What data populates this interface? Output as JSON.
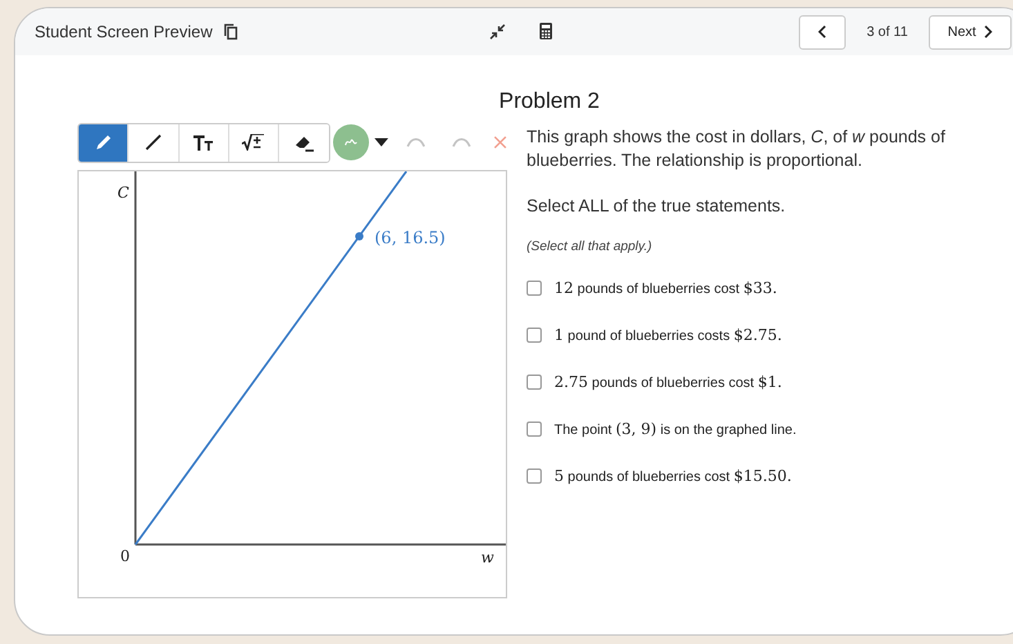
{
  "header": {
    "title": "Student Screen Preview",
    "page_indicator": "3 of 11",
    "next_label": "Next"
  },
  "problem": {
    "title": "Problem 2"
  },
  "toolbar": {
    "tools": [
      {
        "kind": "pencil",
        "selected": true
      },
      {
        "kind": "line",
        "selected": false
      },
      {
        "kind": "text",
        "selected": false
      },
      {
        "kind": "math",
        "selected": false
      },
      {
        "kind": "eraser",
        "selected": false
      }
    ],
    "color": "#8dbf8f",
    "undo_disabled": true,
    "redo_disabled": true
  },
  "graph": {
    "y_label": "C",
    "x_label": "w",
    "origin_label": "0",
    "point_label": "(6, 16.5)"
  },
  "prompt": {
    "intro": "This graph shows the cost in dollars, *C*, of *w* pounds of blueberries. The relationship is proportional.",
    "instruction": "Select ALL of the true statements.",
    "hint": "(Select all that apply.)"
  },
  "options": [
    {
      "checked": false,
      "parts": [
        {
          "kind": "math",
          "text": "12"
        },
        {
          "kind": "text",
          "text": " pounds of blueberries cost "
        },
        {
          "kind": "math",
          "text": "$33"
        },
        {
          "kind": "math",
          "text": "."
        }
      ]
    },
    {
      "checked": false,
      "parts": [
        {
          "kind": "math",
          "text": "1"
        },
        {
          "kind": "text",
          "text": " pound of blueberries costs "
        },
        {
          "kind": "math",
          "text": "$2.75"
        },
        {
          "kind": "math",
          "text": "."
        }
      ]
    },
    {
      "checked": false,
      "parts": [
        {
          "kind": "math",
          "text": "2.75"
        },
        {
          "kind": "text",
          "text": " pounds of blueberries cost "
        },
        {
          "kind": "math",
          "text": "$1"
        },
        {
          "kind": "math",
          "text": "."
        }
      ]
    },
    {
      "checked": false,
      "parts": [
        {
          "kind": "text",
          "text": "The point "
        },
        {
          "kind": "math",
          "text": "(3, 9)"
        },
        {
          "kind": "text",
          "text": " is on the graphed line."
        }
      ]
    },
    {
      "checked": false,
      "parts": [
        {
          "kind": "math",
          "text": "5"
        },
        {
          "kind": "text",
          "text": " pounds of blueberries cost "
        },
        {
          "kind": "math",
          "text": "$15.50"
        },
        {
          "kind": "math",
          "text": "."
        }
      ]
    }
  ]
}
